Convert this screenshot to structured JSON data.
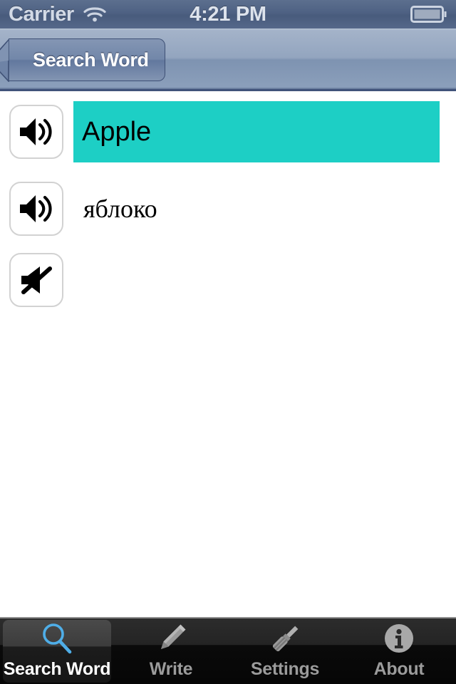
{
  "status_bar": {
    "carrier": "Carrier",
    "wifi_icon": "wifi-icon",
    "time": "4:21 PM",
    "battery_icon": "battery-icon"
  },
  "nav_bar": {
    "back_button_label": "Search Word",
    "back_arrow_icon": "back-arrow-icon"
  },
  "content": {
    "rows": [
      {
        "speaker_icon": "speaker-on-icon",
        "text": "Apple",
        "highlight_color": "#1DCFC5",
        "highlighted": true
      },
      {
        "speaker_icon": "speaker-on-icon",
        "text": "яблоко",
        "highlighted": false
      },
      {
        "speaker_icon": "speaker-muted-icon",
        "text": "",
        "highlighted": false
      }
    ]
  },
  "tab_bar": {
    "tabs": [
      {
        "label": "Search Word",
        "icon": "magnifying-glass-icon",
        "selected": true
      },
      {
        "label": "Write",
        "icon": "pencil-icon",
        "selected": false
      },
      {
        "label": "Settings",
        "icon": "screwdriver-icon",
        "selected": false
      },
      {
        "label": "About",
        "icon": "info-circle-icon",
        "selected": false
      }
    ],
    "selected_icon_color": "#4FAEE8",
    "icon_color": "#8E8E8E"
  }
}
